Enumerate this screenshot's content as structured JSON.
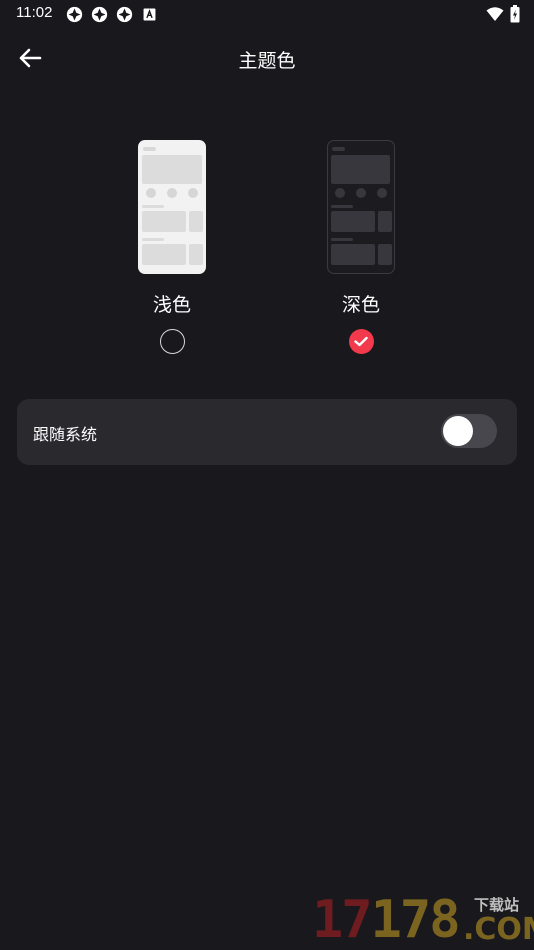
{
  "status_bar": {
    "time": "11:02",
    "icons": [
      "sync-icon",
      "sync-icon",
      "sync-icon",
      "a-icon"
    ],
    "right_icons": [
      "wifi-icon",
      "battery-charging-icon"
    ]
  },
  "header": {
    "back_icon": "arrow-left-icon",
    "title": "主题色"
  },
  "themes": [
    {
      "label": "浅色",
      "selected": false
    },
    {
      "label": "深色",
      "selected": true
    }
  ],
  "follow_system": {
    "label": "跟随系统",
    "enabled": false
  },
  "watermark": {
    "digits_a": "17",
    "digits_b": "178",
    "suffix": "COM",
    "cn": "下载站"
  },
  "colors": {
    "background": "#19181d",
    "card": "#2a292e",
    "accent": "#f23a4c",
    "toggle_track": "#48474d"
  }
}
